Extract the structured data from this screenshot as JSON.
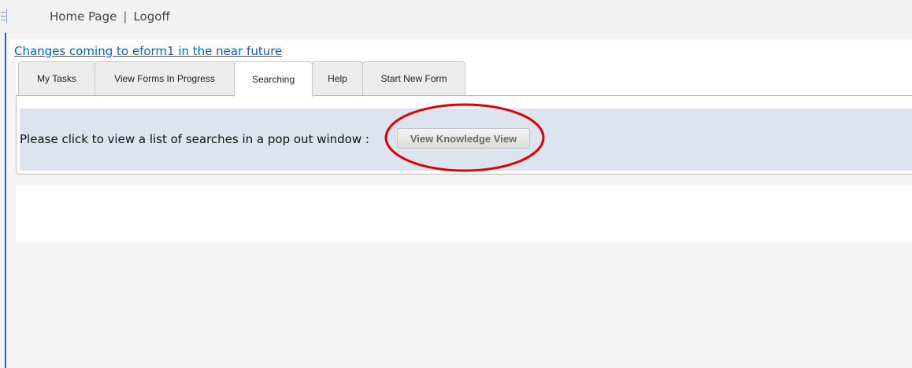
{
  "topnav": {
    "home_label": "Home Page",
    "separator": "|",
    "logoff_label": "Logoff"
  },
  "announcement": {
    "link_text": "Changes coming to eform1 in the near future"
  },
  "tabs": [
    {
      "label": "My Tasks",
      "active": false
    },
    {
      "label": "View Forms In Progress",
      "active": false
    },
    {
      "label": "Searching",
      "active": true
    },
    {
      "label": "Help",
      "active": false
    },
    {
      "label": "Start New Form",
      "active": false
    }
  ],
  "searching_panel": {
    "prompt_text": "Please click to view a list of searches in a pop out window :",
    "button_label": "View Knowledge View"
  },
  "colors": {
    "link": "#0563c1",
    "band": "#dce4ef",
    "highlight": "#e00000"
  },
  "icons": {
    "menu": "hamburger-menu-icon"
  }
}
